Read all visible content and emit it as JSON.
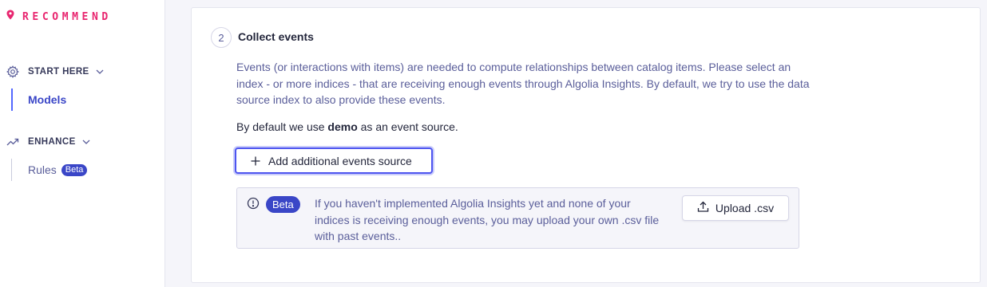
{
  "brand": {
    "name": "RECOMMEND",
    "color": "#e8256f",
    "icon": "location-pin-icon"
  },
  "sidebar": {
    "sections": [
      {
        "label": "START HERE",
        "icon": "gear-icon",
        "items": [
          {
            "label": "Models",
            "active": true
          }
        ]
      },
      {
        "label": "ENHANCE",
        "icon": "trending-up-icon",
        "items": [
          {
            "label": "Rules",
            "badge": "Beta"
          }
        ]
      }
    ]
  },
  "step": {
    "number": "2",
    "title": "Collect events",
    "description": "Events (or interactions with items) are needed to compute relationships between catalog items. Please select an index - or more indices - that are receiving enough events through Algolia Insights. By default, we try to use the data source index to also provide these events.",
    "default_prefix": "By default we use",
    "default_index": "demo",
    "default_suffix": "as an event source.",
    "add_button_label": "Add additional events source"
  },
  "beta_notice": {
    "badge": "Beta",
    "text": "If you haven't implemented Algolia Insights yet and none of your indices is receiving enough events, you may upload your own .csv file with past events..",
    "upload_label": "Upload .csv"
  },
  "colors": {
    "accent": "#3a46c7",
    "focus": "#4e55f0",
    "text": "#23263b",
    "muted": "#5a5e9a"
  }
}
